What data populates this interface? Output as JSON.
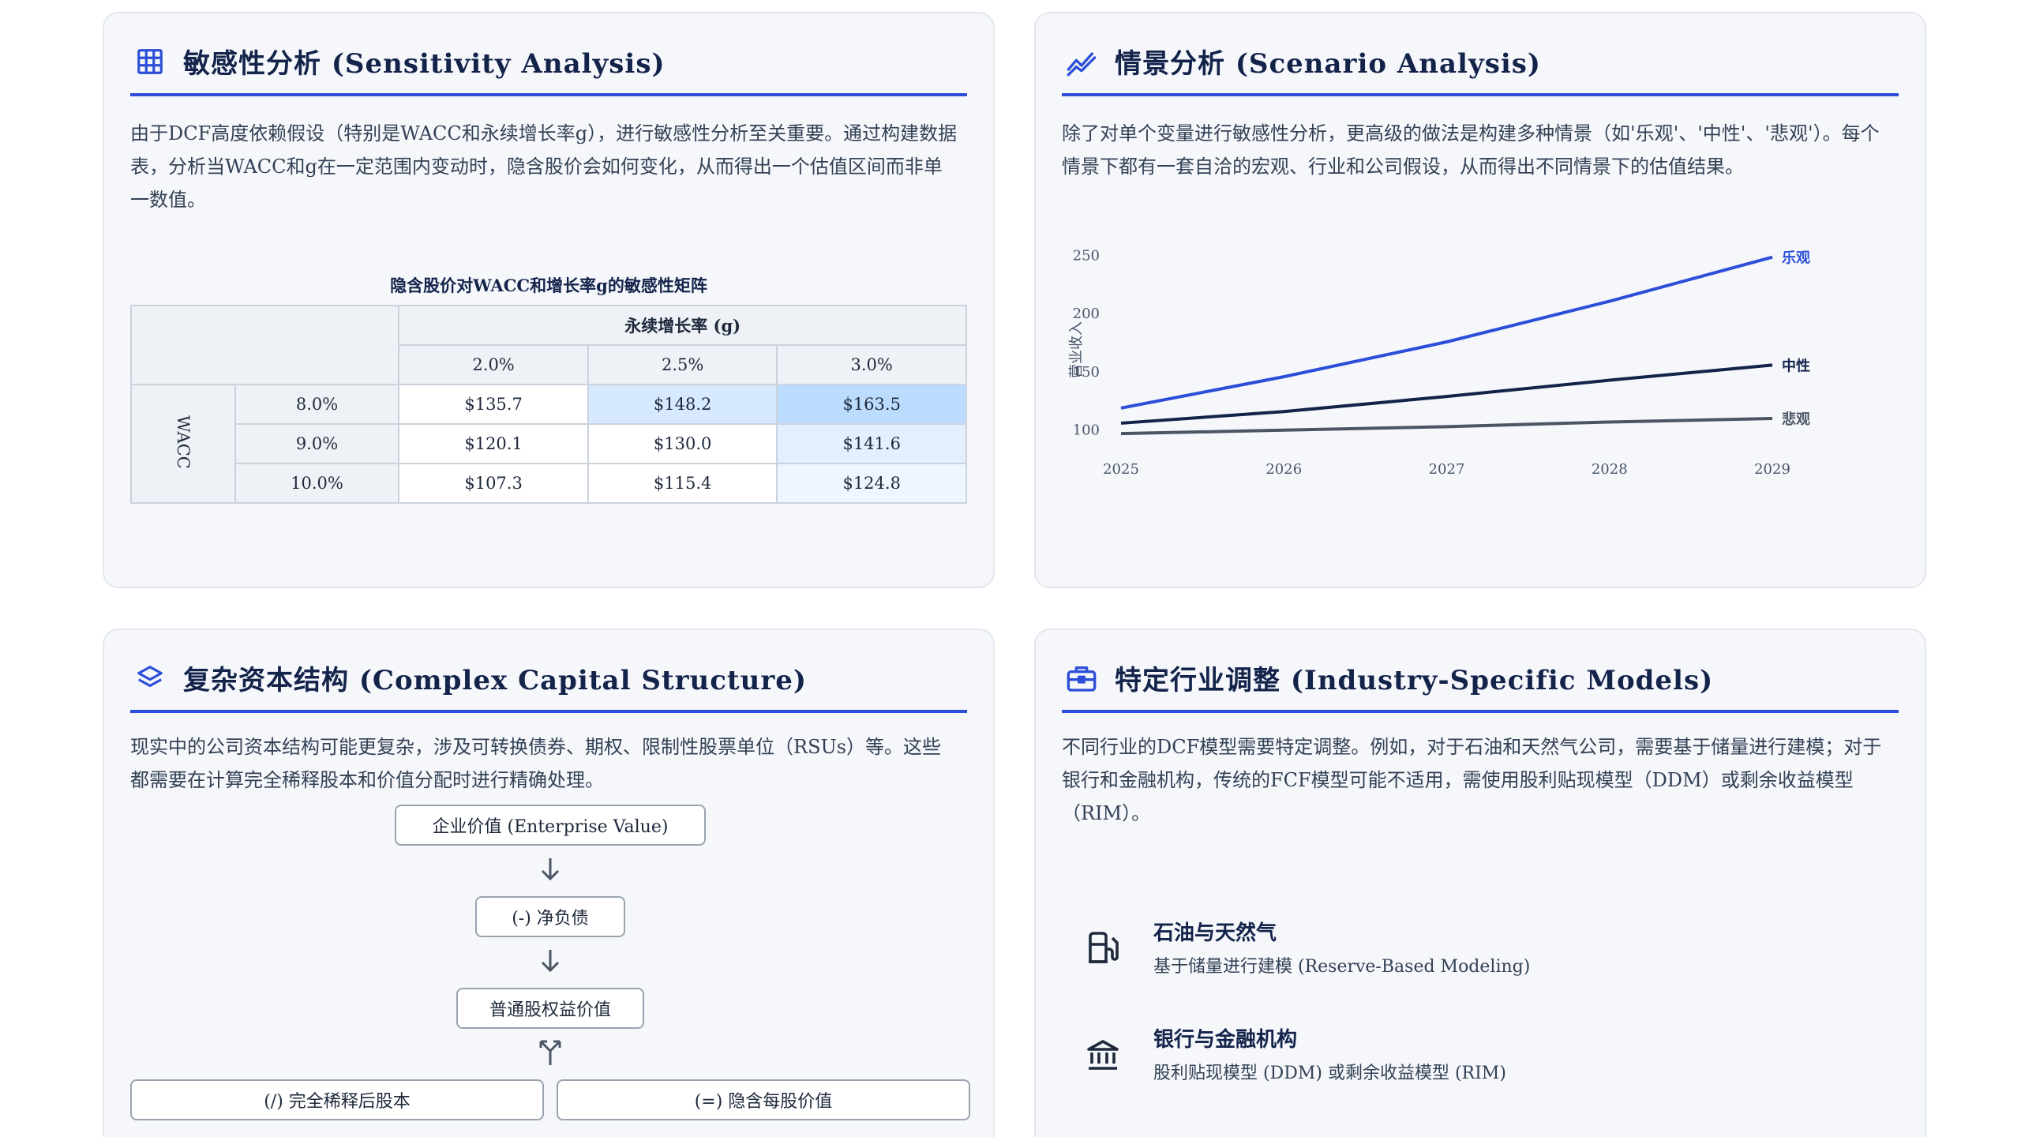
{
  "sensitivity": {
    "icon": "grid-icon",
    "title": "敏感性分析 (Sensitivity Analysis)",
    "description": "由于DCF高度依赖假设（特别是WACC和永续增长率g），进行敏感性分析至关重要。通过构建数据表，分析当WACC和g在一定范围内变动时，隐含股价会如何变化，从而得出一个估值区间而非单一数值。",
    "table_caption": "隐含股价对WACC和增长率g的敏感性矩阵",
    "growth_header": "永续增长率 (g)",
    "wacc_header": "WACC",
    "growth_rates": [
      "2.0%",
      "2.5%",
      "3.0%"
    ],
    "rows": [
      {
        "wacc": "8.0%",
        "cells": [
          "$135.7",
          "$148.2",
          "$163.5"
        ]
      },
      {
        "wacc": "9.0%",
        "cells": [
          "$120.1",
          "$130.0",
          "$141.6"
        ]
      },
      {
        "wacc": "10.0%",
        "cells": [
          "$107.3",
          "$115.4",
          "$124.8"
        ]
      }
    ]
  },
  "scenario": {
    "icon": "trend-icon",
    "title": "情景分析 (Scenario Analysis)",
    "description": "除了对单个变量进行敏感性分析，更高级的做法是构建多种情景（如'乐观'、'中性'、'悲观'）。每个情景下都有一套自洽的宏观、行业和公司假设，从而得出不同情景下的估值结果。"
  },
  "chart_data": {
    "type": "line",
    "x": [
      2025,
      2026,
      2027,
      2028,
      2029
    ],
    "ylabel": "营业收入",
    "y_ticks": [
      100,
      150,
      200,
      250
    ],
    "x_ticks": [
      "2025",
      "2026",
      "2027",
      "2028",
      "2029"
    ],
    "ylim": [
      90,
      260
    ],
    "grid": false,
    "series": [
      {
        "name": "乐观",
        "color": "#2c4ed8",
        "values": [
          118,
          145,
          175,
          210,
          248
        ]
      },
      {
        "name": "中性",
        "color": "#13234a",
        "values": [
          105,
          115,
          128,
          142,
          155
        ]
      },
      {
        "name": "悲观",
        "color": "#4b5563",
        "values": [
          96,
          99,
          102,
          106,
          109
        ]
      }
    ]
  },
  "capital": {
    "icon": "layers-icon",
    "title": "复杂资本结构 (Complex Capital Structure)",
    "description": "现实中的公司资本结构可能更复杂，涉及可转换债券、期权、限制性股票单位（RSUs）等。这些都需要在计算完全稀释股本和价值分配时进行精确处理。",
    "flow": {
      "ev": "企业价值 (Enterprise Value)",
      "debt": "(-) 净负债",
      "equity": "普通股权益价值",
      "shares": "(/) 完全稀释后股本",
      "price": "(=) 隐含每股价值"
    }
  },
  "industry": {
    "icon": "briefcase-icon",
    "title": "特定行业调整 (Industry-Specific Models)",
    "description": "不同行业的DCF模型需要特定调整。例如，对于石油和天然气公司，需要基于储量进行建模；对于银行和金融机构，传统的FCF模型可能不适用，需使用股利贴现模型（DDM）或剩余收益模型（RIM）。",
    "items": [
      {
        "icon": "fuel-pump-icon",
        "name": "石油与天然气",
        "sub": "基于储量进行建模 (Reserve-Based Modeling)"
      },
      {
        "icon": "bank-icon",
        "name": "银行与金融机构",
        "sub": "股利贴现模型 (DDM) 或剩余收益模型 (RIM)"
      }
    ]
  }
}
